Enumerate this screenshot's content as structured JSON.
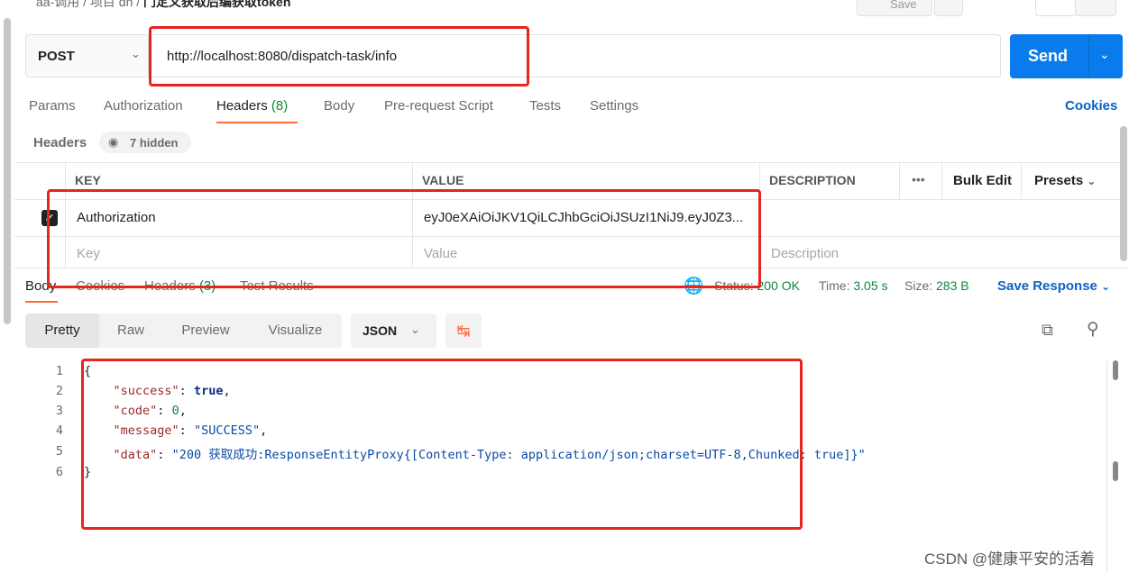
{
  "breadcrumb": {
    "parent": "aa-调用 / 项目 dn /",
    "current": "门定义获取后编获取token"
  },
  "top_actions": {
    "save_label": "Save"
  },
  "request": {
    "method": "POST",
    "url": "http://localhost:8080/dispatch-task/info",
    "send_label": "Send"
  },
  "request_tabs": [
    {
      "label": "Params"
    },
    {
      "label": "Authorization"
    },
    {
      "label": "Headers",
      "count": "(8)"
    },
    {
      "label": "Body"
    },
    {
      "label": "Pre-request Script"
    },
    {
      "label": "Tests"
    },
    {
      "label": "Settings"
    }
  ],
  "cookies_label": "Cookies",
  "headers_section": {
    "title": "Headers",
    "hidden_label": "7 hidden"
  },
  "table": {
    "columns": {
      "key": "KEY",
      "value": "VALUE",
      "description": "DESCRIPTION"
    },
    "more_label": "•••",
    "bulk_edit_label": "Bulk Edit",
    "presets_label": "Presets",
    "rows": [
      {
        "checked": true,
        "key": "Authorization",
        "value": "eyJ0eXAiOiJKV1QiLCJhbGciOiJSUzI1NiJ9.eyJ0Z3...",
        "description": ""
      }
    ],
    "placeholders": {
      "key": "Key",
      "value": "Value",
      "description": "Description"
    }
  },
  "response_tabs": [
    {
      "label": "Body"
    },
    {
      "label": "Cookies"
    },
    {
      "label": "Headers",
      "count": "(3)"
    },
    {
      "label": "Test Results"
    }
  ],
  "response_meta": {
    "status_label": "Status:",
    "status_value": "200 OK",
    "time_label": "Time:",
    "time_value": "3.05 s",
    "size_label": "Size:",
    "size_value": "283 B",
    "save_response_label": "Save Response"
  },
  "format": {
    "modes": [
      "Pretty",
      "Raw",
      "Preview",
      "Visualize"
    ],
    "active_mode": "Pretty",
    "language": "JSON"
  },
  "response_body": {
    "line_numbers": [
      "1",
      "2",
      "3",
      "4",
      "5",
      "6"
    ],
    "open_brace": "{",
    "close_brace": "}",
    "success_key": "\"success\"",
    "success_value": "true",
    "code_key": "\"code\"",
    "code_value": "0",
    "message_key": "\"message\"",
    "message_value": "\"SUCCESS\"",
    "data_key": "\"data\"",
    "data_value": "\"200 获取成功:ResponseEntityProxy{[Content-Type: application/json;charset=UTF-8,Chunked: true]}\""
  },
  "watermark": "CSDN @健康平安的活着",
  "colors": {
    "accent": "#ff6c37",
    "primary": "#097bed",
    "annotation": "#e8241f",
    "ok": "#0a8a3a"
  },
  "icons": {
    "method": "chevron-down-icon",
    "wrap": "wrap-lines-icon",
    "copy": "copy-icon",
    "search": "search-icon",
    "globe": "globe-icon"
  }
}
